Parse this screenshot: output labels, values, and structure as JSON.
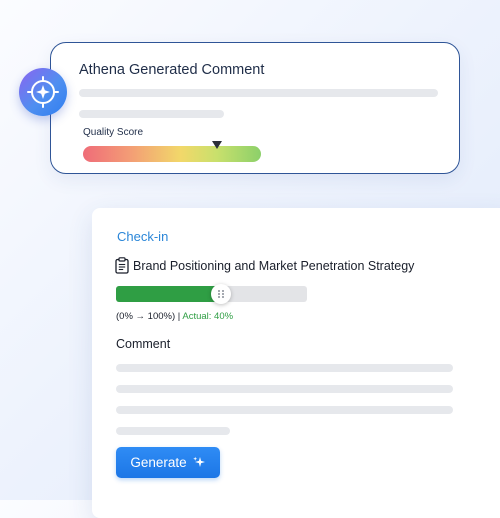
{
  "comment_card": {
    "title": "Athena Generated Comment",
    "quality_label": "Quality Score",
    "quality_score_fraction": 0.75
  },
  "checkin": {
    "title": "Check-in",
    "objective_name": "Brand Positioning and Market Penetration Strategy",
    "progress_fraction": 0.55,
    "progress_range_text": "(0% → 100%) | ",
    "actual_text": "Actual: 40%",
    "comment_heading": "Comment",
    "generate_label": "Generate"
  },
  "icons": {
    "athena": "compass-star-icon",
    "objective": "clipboard-icon",
    "handle": "drag-handle-icon",
    "generate": "sparkle-icon"
  },
  "colors": {
    "accent": "#2a86d8",
    "card_border": "#2f5597",
    "progress": "#2f9e44",
    "button": "#1c76e6"
  }
}
